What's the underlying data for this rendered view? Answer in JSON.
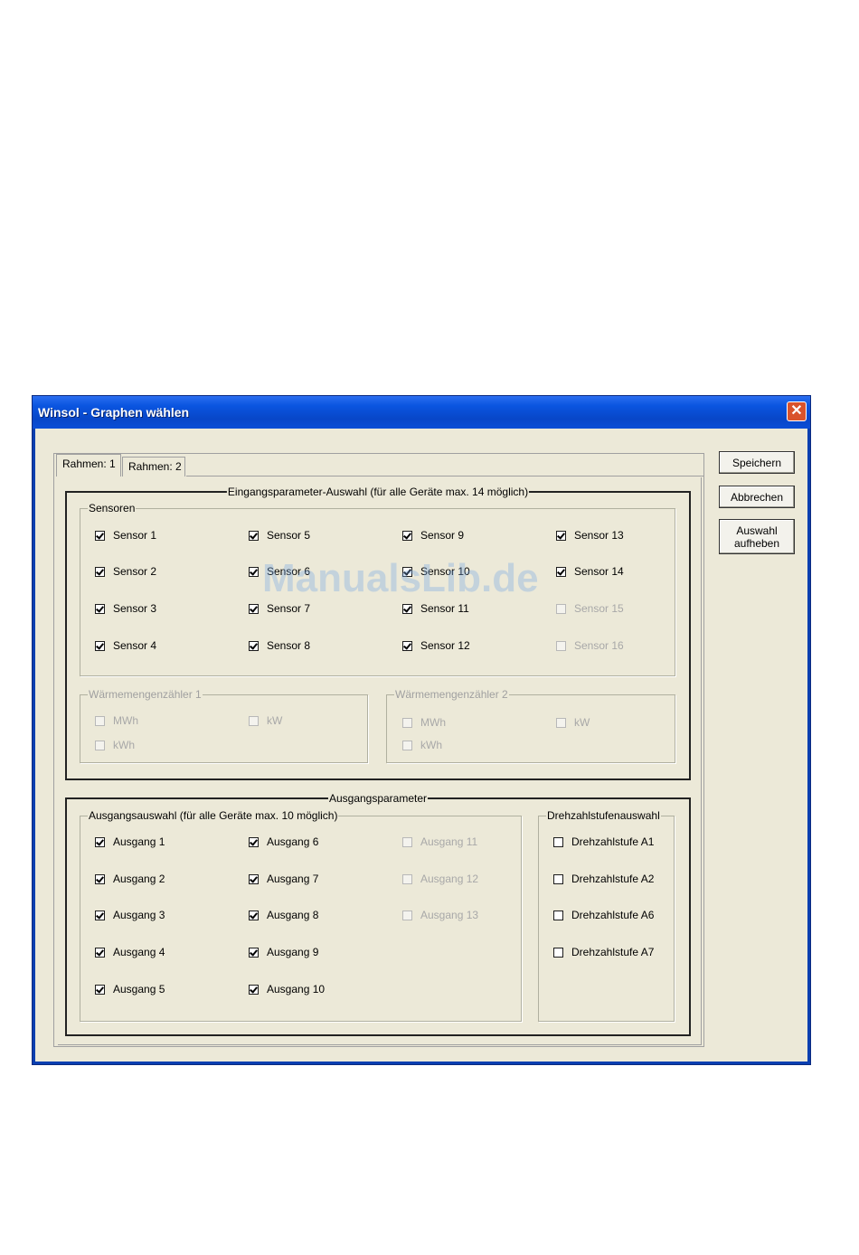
{
  "window": {
    "title": "Winsol - Graphen wählen",
    "close_label": "✕"
  },
  "tabs": [
    {
      "label": "Rahmen: 1"
    },
    {
      "label": "Rahmen: 2"
    }
  ],
  "buttons": {
    "save": "Speichern",
    "cancel": "Abbrechen",
    "clear": "Auswahl\naufheben"
  },
  "input_group": {
    "title": "Eingangsparameter-Auswahl (für alle Geräte max. 14 möglich)",
    "sensors": {
      "title": "Sensoren",
      "items": [
        {
          "label": "Sensor 1",
          "checked": true,
          "enabled": true
        },
        {
          "label": "Sensor 2",
          "checked": true,
          "enabled": true
        },
        {
          "label": "Sensor 3",
          "checked": true,
          "enabled": true
        },
        {
          "label": "Sensor 4",
          "checked": true,
          "enabled": true
        },
        {
          "label": "Sensor 5",
          "checked": true,
          "enabled": true
        },
        {
          "label": "Sensor 6",
          "checked": true,
          "enabled": true
        },
        {
          "label": "Sensor 7",
          "checked": true,
          "enabled": true
        },
        {
          "label": "Sensor 8",
          "checked": true,
          "enabled": true
        },
        {
          "label": "Sensor 9",
          "checked": true,
          "enabled": true
        },
        {
          "label": "Sensor 10",
          "checked": true,
          "enabled": true
        },
        {
          "label": "Sensor 11",
          "checked": true,
          "enabled": true
        },
        {
          "label": "Sensor 12",
          "checked": true,
          "enabled": true
        },
        {
          "label": "Sensor 13",
          "checked": true,
          "enabled": true
        },
        {
          "label": "Sensor 14",
          "checked": true,
          "enabled": true
        },
        {
          "label": "Sensor 15",
          "checked": false,
          "enabled": false
        },
        {
          "label": "Sensor 16",
          "checked": false,
          "enabled": false
        }
      ]
    },
    "heat1": {
      "title": "Wärmemengenzähler 1",
      "items": [
        {
          "label": "MWh"
        },
        {
          "label": "kWh"
        },
        {
          "label": "kW"
        }
      ]
    },
    "heat2": {
      "title": "Wärmemengenzähler 2",
      "items": [
        {
          "label": "MWh"
        },
        {
          "label": "kWh"
        },
        {
          "label": "kW"
        }
      ]
    }
  },
  "output_group": {
    "title": "Ausgangsparameter",
    "outputs": {
      "title": "Ausgangsauswahl (für alle Geräte max. 10 möglich)",
      "items": [
        {
          "label": "Ausgang 1",
          "checked": true,
          "enabled": true
        },
        {
          "label": "Ausgang 2",
          "checked": true,
          "enabled": true
        },
        {
          "label": "Ausgang 3",
          "checked": true,
          "enabled": true
        },
        {
          "label": "Ausgang 4",
          "checked": true,
          "enabled": true
        },
        {
          "label": "Ausgang 5",
          "checked": true,
          "enabled": true
        },
        {
          "label": "Ausgang 6",
          "checked": true,
          "enabled": true
        },
        {
          "label": "Ausgang 7",
          "checked": true,
          "enabled": true
        },
        {
          "label": "Ausgang 8",
          "checked": true,
          "enabled": true
        },
        {
          "label": "Ausgang 9",
          "checked": true,
          "enabled": true
        },
        {
          "label": "Ausgang 10",
          "checked": true,
          "enabled": true
        },
        {
          "label": "Ausgang 11",
          "checked": false,
          "enabled": false
        },
        {
          "label": "Ausgang 12",
          "checked": false,
          "enabled": false
        },
        {
          "label": "Ausgang 13",
          "checked": false,
          "enabled": false
        }
      ]
    },
    "speeds": {
      "title": "Drehzahlstufenauswahl",
      "items": [
        {
          "label": "Drehzahlstufe A1",
          "checked": false
        },
        {
          "label": "Drehzahlstufe A2",
          "checked": false
        },
        {
          "label": "Drehzahlstufe A6",
          "checked": false
        },
        {
          "label": "Drehzahlstufe A7",
          "checked": false
        }
      ]
    }
  },
  "watermark": "ManualsLib.de"
}
